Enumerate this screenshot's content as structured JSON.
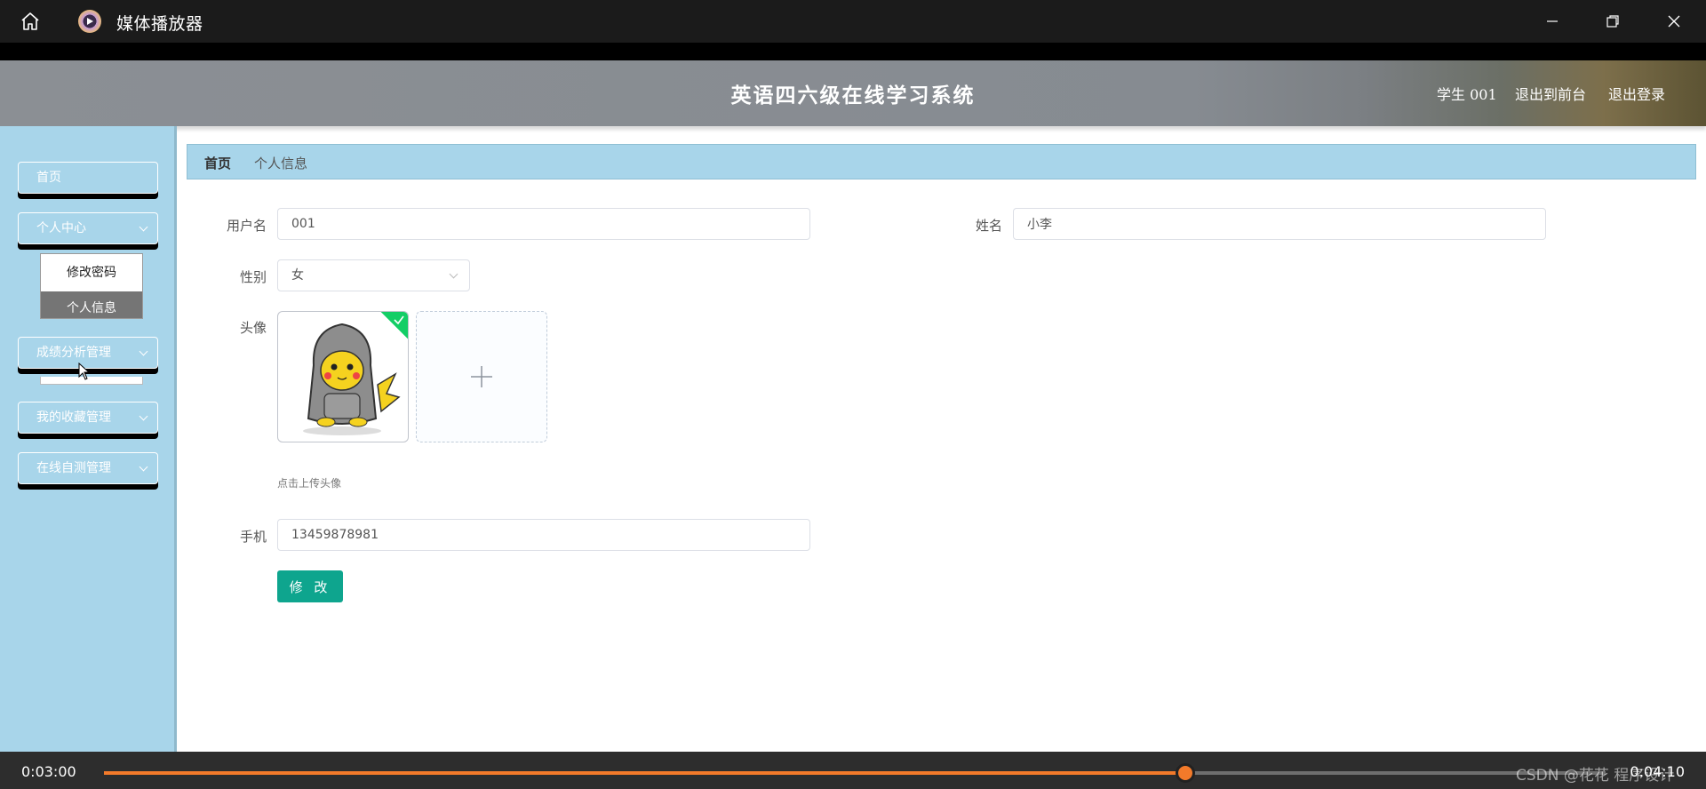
{
  "window": {
    "title": "媒体播放器"
  },
  "header": {
    "title": "英语四六级在线学习系统",
    "user": "学生  001",
    "to_front": "退出到前台",
    "logout": "退出登录"
  },
  "sidebar": {
    "items": [
      {
        "label": "首页"
      },
      {
        "label": "个人中心",
        "submenu": [
          "修改密码",
          "个人信息"
        ]
      },
      {
        "label": "成绩分析管理"
      },
      {
        "label": "我的收藏管理"
      },
      {
        "label": "在线自测管理"
      }
    ]
  },
  "breadcrumb": {
    "home": "首页",
    "current": "个人信息"
  },
  "form": {
    "username_label": "用户名",
    "username_value": "001",
    "name_label": "姓名",
    "name_value": "小李",
    "gender_label": "性别",
    "gender_value": "女",
    "avatar_label": "头像",
    "upload_hint": "点击上传头像",
    "phone_label": "手机",
    "phone_value": "13459878981",
    "submit_label": "修 改"
  },
  "player": {
    "current_time": "0:03:00",
    "total_time": "0:04:10",
    "progress": 0.72,
    "watermark": "CSDN @花花 程序设计"
  },
  "colors": {
    "sidebar_bg": "#a8d5ea",
    "accent_button": "#0ea58e",
    "progress": "#f37a2a",
    "avatar_check": "#13ce66"
  }
}
